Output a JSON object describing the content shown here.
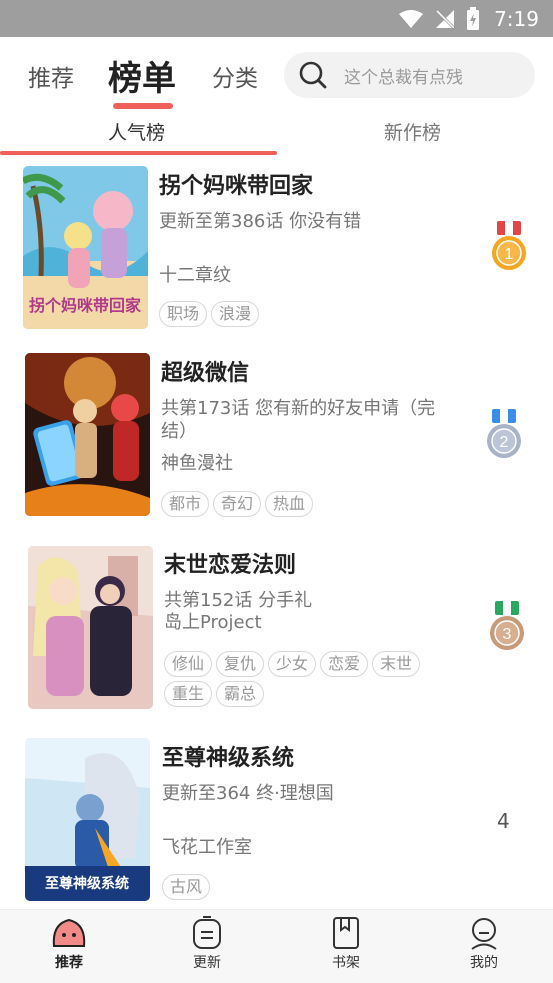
{
  "status": {
    "time": "7:19"
  },
  "top_nav": {
    "tabs": [
      "推荐",
      "榜单",
      "分类"
    ],
    "search_placeholder": "这个总裁有点残"
  },
  "sub_tabs": [
    "人气榜",
    "新作榜"
  ],
  "comics": [
    {
      "title": "拐个妈咪带回家",
      "desc": "更新至第386话 你没有错",
      "author": "十二章纹",
      "tags": [
        "职场",
        "浪漫"
      ],
      "rank": "1",
      "cover_text": "拐个妈咪带回家"
    },
    {
      "title": "超级微信",
      "desc": "共第173话 您有新的好友申请（完结）",
      "author": "神鱼漫社",
      "tags": [
        "都市",
        "奇幻",
        "热血"
      ],
      "rank": "2",
      "cover_text": ""
    },
    {
      "title": "末世恋爱法则",
      "desc": "共第152话 分手礼",
      "author": "岛上Project",
      "tags": [
        "修仙",
        "复仇",
        "少女",
        "恋爱",
        "末世",
        "重生",
        "霸总"
      ],
      "rank": "3",
      "cover_text": ""
    },
    {
      "title": "至尊神级系统",
      "desc": "更新至364 终·理想国",
      "author": "飞花工作室",
      "tags": [
        "古风"
      ],
      "rank": "4",
      "cover_text": "至尊神级系统"
    }
  ],
  "bottom_nav": [
    "推荐",
    "更新",
    "书架",
    "我的"
  ],
  "colors": {
    "accent": "#f0605a",
    "gold": "#f5a623",
    "silver": "#a9b3c6",
    "bronze": "#c99a7a"
  }
}
